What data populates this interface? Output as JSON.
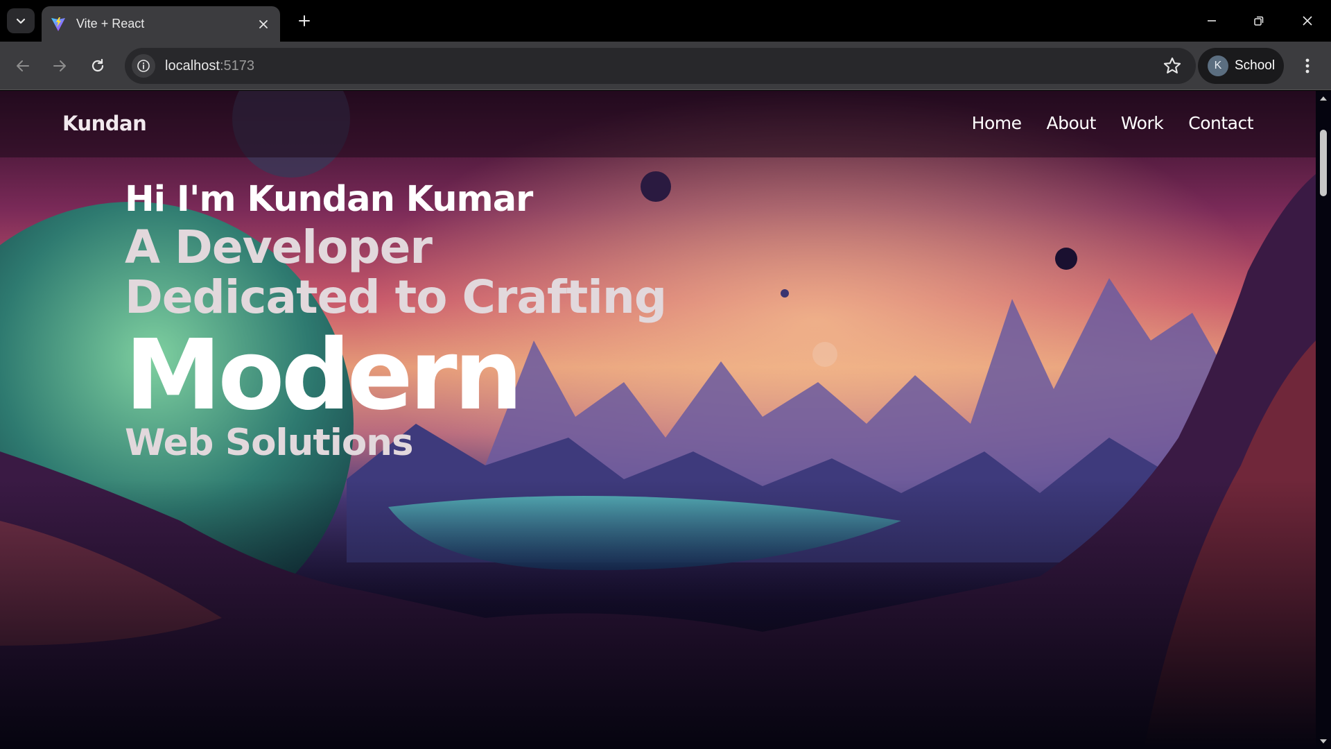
{
  "browser": {
    "tab_title": "Vite + React",
    "url_host": "localhost",
    "url_port": ":5173",
    "profile_initial": "K",
    "profile_name": "School",
    "icons": {
      "tab_menu": "chevron-down-icon",
      "favicon": "vite-logo-icon",
      "tab_close": "close-icon",
      "new_tab": "plus-icon",
      "minimize": "minimize-icon",
      "restore": "restore-icon",
      "close_window": "close-icon",
      "back": "arrow-left-icon",
      "forward": "arrow-right-icon",
      "reload": "reload-icon",
      "site_info": "info-icon",
      "bookmark": "star-icon",
      "menu": "more-vertical-icon"
    }
  },
  "site": {
    "logo": "Kundan",
    "nav": [
      "Home",
      "About",
      "Work",
      "Contact"
    ]
  },
  "hero": {
    "greeting": "Hi I'm Kundan Kumar",
    "line2": "A Developer",
    "line3": "Dedicated to Crafting",
    "highlight": "Modern",
    "line5": "Web Solutions"
  },
  "colors": {
    "chrome_bg": "#000000",
    "toolbar_bg": "#3c3c3f",
    "page_bg": "#05040f",
    "sky_top": "#3a1030",
    "sky_glow": "#e8a070"
  }
}
